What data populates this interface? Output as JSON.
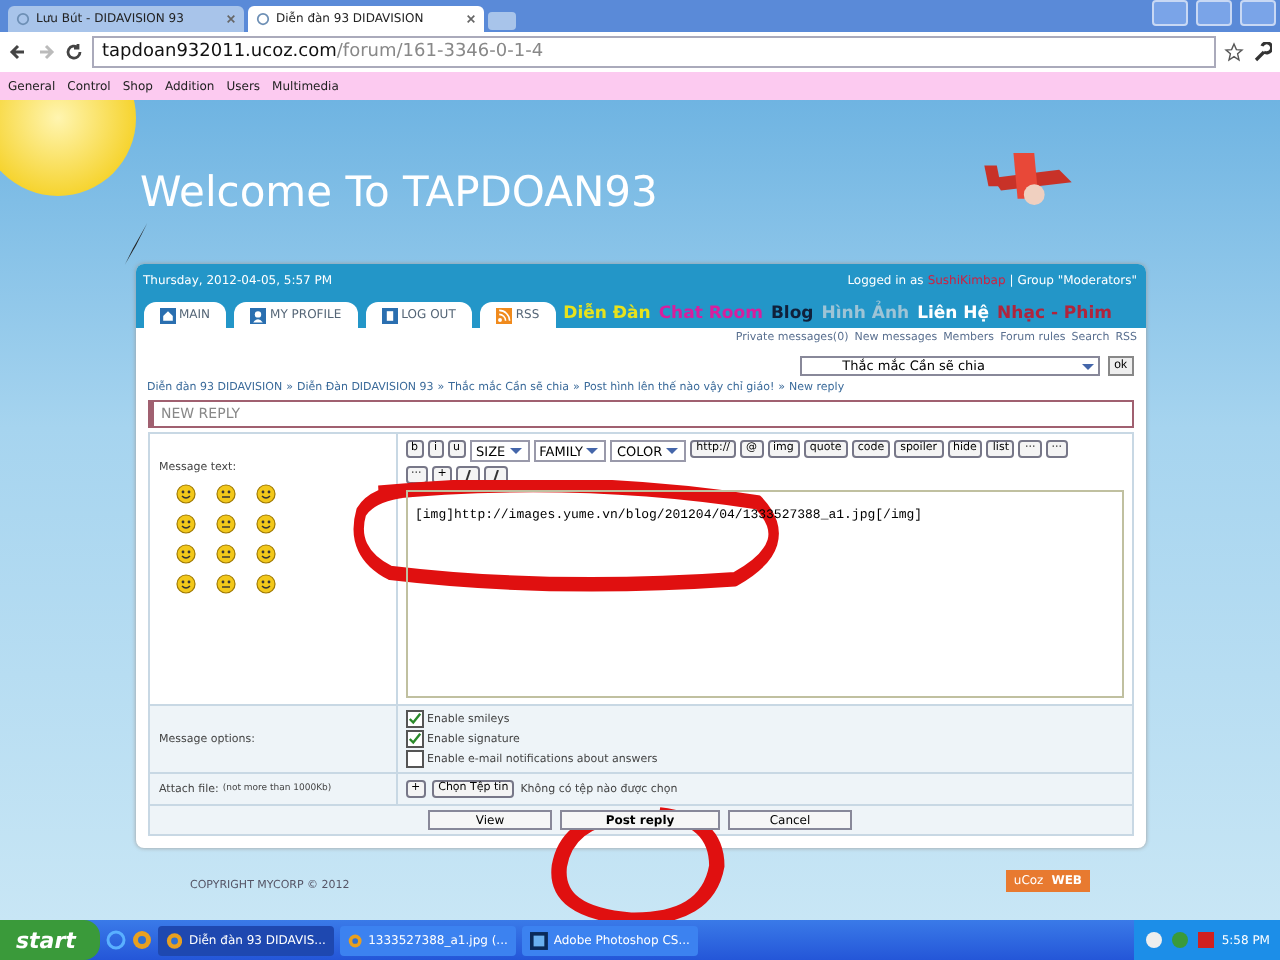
{
  "browser": {
    "tabs": [
      {
        "label": "Lưu Bút - DIDAVISION 93",
        "selected": false
      },
      {
        "label": "Diễn đàn 93 DIDAVISION",
        "selected": true
      }
    ],
    "address": {
      "host": "tapdoan932011.ucoz.com",
      "path": "/forum/161-3346-0-1-4"
    },
    "bookmarks": [
      "General",
      "Control",
      "Shop",
      "Addition",
      "Users",
      "Multimedia"
    ]
  },
  "site": {
    "title": "Welcome To TAPDOAN93"
  },
  "topbar": {
    "date": "Thursday, 2012-04-05, 5:57 PM",
    "logged_prefix": "Logged in as",
    "username": "SushiKimbap",
    "group": "| Group \"Moderators\""
  },
  "nav_tabs": [
    {
      "label": "MAIN",
      "kind": "home"
    },
    {
      "label": "MY PROFILE",
      "kind": "profile"
    },
    {
      "label": "LOG OUT",
      "kind": "logout"
    },
    {
      "label": "RSS",
      "kind": "rss"
    }
  ],
  "nav_links": [
    {
      "label": "Diễn Đàn",
      "color": "#e8e21c"
    },
    {
      "label": "Chat Room",
      "color": "#d81e9e"
    },
    {
      "label": "Blog",
      "color": "#10203a"
    },
    {
      "label": "Hình Ảnh",
      "color": "#9ec4d6"
    },
    {
      "label": "Liên Hệ",
      "color": "#ffffff"
    },
    {
      "label": "Nhạc - Phim",
      "color": "#b0243c"
    }
  ],
  "user_links": [
    "Private messages(0)",
    "New messages",
    "Members",
    "Forum rules",
    "Search",
    "RSS"
  ],
  "forum_jump": {
    "value": "Thắc mắc Cần sẽ chia",
    "button": "ok"
  },
  "breadcrumb_separator": "»",
  "breadcrumb": [
    "Diễn đàn 93 DIDAVISION",
    "Diễn Đàn DIDAVISION 93",
    "Thắc mắc Cần sẽ chia",
    "Post hình lên thế nào vậy chỉ giáo!",
    "New reply"
  ],
  "form": {
    "title": "NEW REPLY",
    "message_label": "Message text:",
    "toolbar": [
      {
        "kind": "button",
        "label": "b"
      },
      {
        "kind": "button",
        "label": "i"
      },
      {
        "kind": "button",
        "label": "u"
      },
      {
        "kind": "select",
        "label": "SIZE"
      },
      {
        "kind": "select",
        "label": "FAMILY"
      },
      {
        "kind": "select",
        "label": "COLOR"
      },
      {
        "kind": "button",
        "label": "http://"
      },
      {
        "kind": "button",
        "label": "@"
      },
      {
        "kind": "button",
        "label": "img"
      },
      {
        "kind": "button",
        "label": "quote"
      },
      {
        "kind": "button",
        "label": "code"
      },
      {
        "kind": "button",
        "label": "spoiler"
      },
      {
        "kind": "button",
        "label": "hide"
      },
      {
        "kind": "button",
        "label": "list"
      },
      {
        "kind": "button",
        "label": "···"
      },
      {
        "kind": "button",
        "label": "···"
      },
      {
        "kind": "button",
        "label": "···"
      },
      {
        "kind": "button",
        "label": "+"
      },
      {
        "kind": "icon"
      },
      {
        "kind": "icon"
      }
    ],
    "message": "[img]http://images.yume.vn/blog/201204/04/1333527388_a1.jpg[/img]",
    "options_label": "Message options:",
    "options": [
      {
        "label": "Enable smileys",
        "checked": true
      },
      {
        "label": "Enable signature",
        "checked": true
      },
      {
        "label": "Enable e-mail notifications about answers",
        "checked": false
      }
    ],
    "attach_label": "Attach file:",
    "attach_note": "(not more than 1000Kb)",
    "attach_plus": "+",
    "attach_button": "Chọn Tệp tin",
    "attach_status": "Không có tệp nào được chọn",
    "buttons": [
      "View",
      "Post reply",
      "Cancel"
    ]
  },
  "footer": {
    "copyright": "COPYRIGHT MYCORP © 2012",
    "badge": "uCoz",
    "badge_web": "WEB"
  },
  "taskbar": {
    "start": "start",
    "items": [
      {
        "label": "Diễn đàn 93 DIDAVIS...",
        "selected": true,
        "kind": "browser"
      },
      {
        "label": "1333527388_a1.jpg (...",
        "selected": false,
        "kind": "browser"
      },
      {
        "label": "Adobe Photoshop CS...",
        "selected": false,
        "kind": "photoshop"
      }
    ],
    "clock": "5:58 PM"
  }
}
